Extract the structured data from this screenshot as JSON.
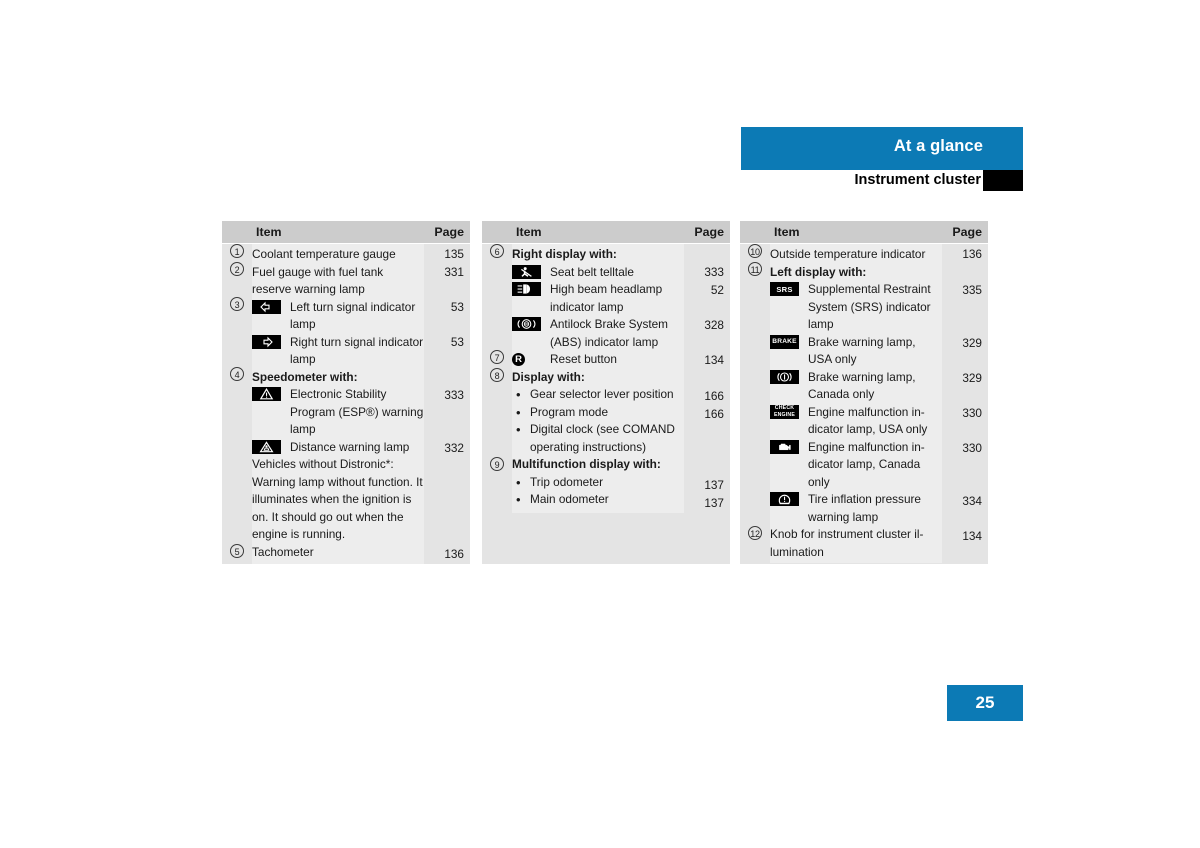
{
  "header": {
    "section_title": "At a glance",
    "page_title": "Instrument cluster",
    "band_color": "#0c7ab5",
    "block_color": "#000000"
  },
  "footer": {
    "page_number": "25"
  },
  "table_headers": {
    "item": "Item",
    "page": "Page"
  },
  "columns": [
    {
      "id": "column-1",
      "rows": [
        {
          "num": "1",
          "type": "plain",
          "text": "Coolant temperature gauge",
          "page": "135"
        },
        {
          "num": "2",
          "type": "plain",
          "text": "Fuel gauge with fuel tank reserve warning lamp",
          "page": "331"
        },
        {
          "num": "3",
          "type": "icon",
          "icon": "turn-signal-left-icon",
          "text": "Left turn signal indicator lamp",
          "page": "53"
        },
        {
          "num": "",
          "type": "icon",
          "icon": "turn-signal-right-icon",
          "text": "Right turn signal indicator lamp",
          "page": "53"
        },
        {
          "num": "4",
          "type": "heading",
          "text": "Speedometer with:",
          "page": ""
        },
        {
          "num": "",
          "type": "icon",
          "icon": "esp-warning-icon",
          "text": "Electronic Stability Program (ESP®) warning lamp",
          "page": "333"
        },
        {
          "num": "",
          "type": "icon",
          "icon": "distance-warning-icon",
          "text": "Distance warning lamp",
          "page": "332"
        },
        {
          "num": "",
          "type": "note",
          "text": "Vehicles without Distronic*: Warning lamp without function. It illuminates when the ignition is on. It should go out when the engine is running.",
          "page": ""
        },
        {
          "num": "5",
          "type": "plain",
          "text": "Tachometer",
          "page": "136"
        }
      ]
    },
    {
      "id": "column-2",
      "rows": [
        {
          "num": "6",
          "type": "heading",
          "text": "Right display with:",
          "page": ""
        },
        {
          "num": "",
          "type": "icon",
          "icon": "seat-belt-telltale-icon",
          "text": "Seat belt telltale",
          "page": "333"
        },
        {
          "num": "",
          "type": "icon",
          "icon": "high-beam-icon",
          "text": "High beam headlamp indicator lamp",
          "page": "52"
        },
        {
          "num": "",
          "type": "icon",
          "icon": "abs-icon",
          "text": "Antilock Brake System (ABS) indicator lamp",
          "page": "328"
        },
        {
          "num": "7",
          "type": "icon",
          "icon": "reset-button-icon",
          "text": "Reset button",
          "page": "134"
        },
        {
          "num": "8",
          "type": "heading",
          "text": "Display with:",
          "page": ""
        },
        {
          "num": "",
          "type": "bullet",
          "text": "Gear selector lever position",
          "page": "166"
        },
        {
          "num": "",
          "type": "bullet",
          "text": "Program mode",
          "page": "166"
        },
        {
          "num": "",
          "type": "bullet",
          "text": "Digital clock (see COMAND operating instructions)",
          "page": ""
        },
        {
          "num": "9",
          "type": "heading",
          "text": "Multifunction display with:",
          "page": ""
        },
        {
          "num": "",
          "type": "bullet",
          "text": "Trip odometer",
          "page": "137"
        },
        {
          "num": "",
          "type": "bullet",
          "text": "Main odometer",
          "page": "137"
        }
      ]
    },
    {
      "id": "column-3",
      "rows": [
        {
          "num": "10",
          "type": "plain",
          "text": "Outside temperature indicator",
          "page": "136"
        },
        {
          "num": "11",
          "type": "heading",
          "text": "Left display with:",
          "page": ""
        },
        {
          "num": "",
          "type": "icon",
          "icon": "srs-icon",
          "text": "Supplemental Restraint System (SRS) indicator lamp",
          "page": "335"
        },
        {
          "num": "",
          "type": "icon",
          "icon": "brake-usa-icon",
          "text": "Brake warning lamp, USA only",
          "page": "329"
        },
        {
          "num": "",
          "type": "icon",
          "icon": "brake-canada-icon",
          "text": "Brake warning lamp, Canada only",
          "page": "329"
        },
        {
          "num": "",
          "type": "icon",
          "icon": "check-engine-usa-icon",
          "text": "Engine malfunction in-dicator lamp, USA only",
          "page": "330"
        },
        {
          "num": "",
          "type": "icon",
          "icon": "check-engine-canada-icon",
          "text": "Engine malfunction in-dicator lamp, Canada only",
          "page": "330"
        },
        {
          "num": "",
          "type": "icon",
          "icon": "tire-pressure-icon",
          "text": "Tire inflation pressure warning lamp",
          "page": "334"
        },
        {
          "num": "12",
          "type": "plain",
          "text": "Knob for instrument cluster il-lumination",
          "page": "134"
        }
      ]
    }
  ],
  "icon_labels": {
    "srs": "SRS",
    "brake": "BRAKE",
    "check": "CHECK",
    "engine": "ENGINE",
    "reset": "R"
  },
  "bullet_glyph": "•"
}
